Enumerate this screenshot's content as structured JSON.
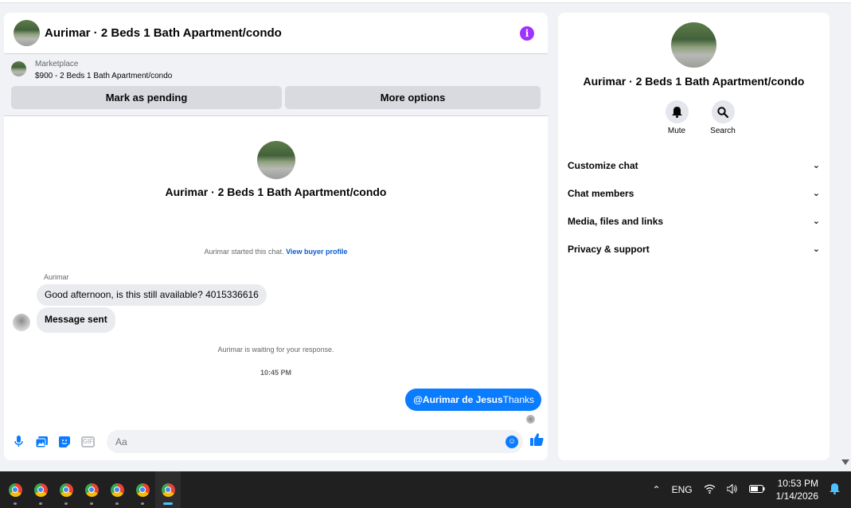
{
  "chat": {
    "title": "Aurimar · 2 Beds 1 Bath Apartment/condo",
    "info_icon": "i",
    "marketplace_label": "Marketplace",
    "listing": "$900 - 2 Beds 1 Bath Apartment/condo",
    "mark_pending": "Mark as pending",
    "more_options": "More options",
    "hero_name": "Aurimar · 2 Beds 1 Bath Apartment/condo",
    "started_text": "Aurimar started this chat.",
    "view_buyer_profile": "View buyer profile",
    "sender_name": "Aurimar",
    "message_1": "Good afternoon, is this still available? 4015336616",
    "message_2": "Message sent",
    "waiting_text": "Aurimar is waiting for your response.",
    "timestamp": "10:45 PM",
    "outgoing_mention": "@Aurimar de Jesus",
    "outgoing_text": "Thanks",
    "composer_placeholder": "Aa"
  },
  "info": {
    "name": "Aurimar · 2 Beds 1 Bath Apartment/condo",
    "mute_label": "Mute",
    "search_label": "Search",
    "sections": [
      "Customize chat",
      "Chat members",
      "Media, files and links",
      "Privacy & support"
    ]
  },
  "taskbar": {
    "apps": [
      "chrome",
      "chrome",
      "chrome",
      "chrome",
      "chrome",
      "chrome",
      "chrome"
    ],
    "language": "ENG",
    "time": "10:53 PM",
    "date": "1/14/2026"
  },
  "colors": {
    "accent": "#0a7cff",
    "info_purple": "#a033ff",
    "taskbar_bg": "#202020"
  },
  "icons": {
    "composer": [
      "microphone-icon",
      "photo-icon",
      "sticker-icon",
      "gif-icon",
      "emoji-icon",
      "thumbs-up-icon"
    ],
    "actions": [
      "bell-icon",
      "search-icon"
    ]
  }
}
